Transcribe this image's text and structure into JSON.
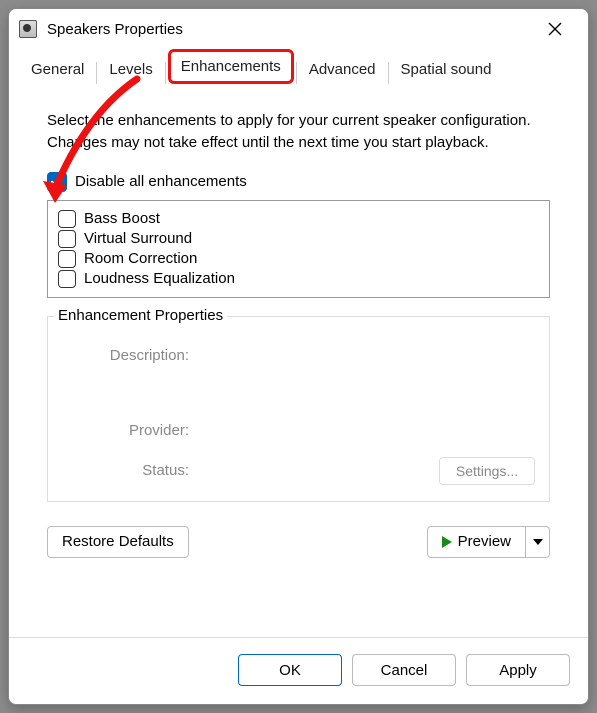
{
  "title": "Speakers Properties",
  "tabs": [
    "General",
    "Levels",
    "Enhancements",
    "Advanced",
    "Spatial sound"
  ],
  "active_tab_index": 2,
  "intro": "Select the enhancements to apply for your current speaker configuration. Changes may not take effect until the next time you start playback.",
  "disable_all_label": "Disable all enhancements",
  "disable_all_checked": true,
  "enhancements": [
    "Bass Boost",
    "Virtual Surround",
    "Room Correction",
    "Loudness Equalization"
  ],
  "group_title": "Enhancement Properties",
  "props": {
    "description_label": "Description:",
    "provider_label": "Provider:",
    "status_label": "Status:"
  },
  "settings_label": "Settings...",
  "restore_label": "Restore Defaults",
  "preview_label": "Preview",
  "footer": {
    "ok": "OK",
    "cancel": "Cancel",
    "apply": "Apply"
  }
}
